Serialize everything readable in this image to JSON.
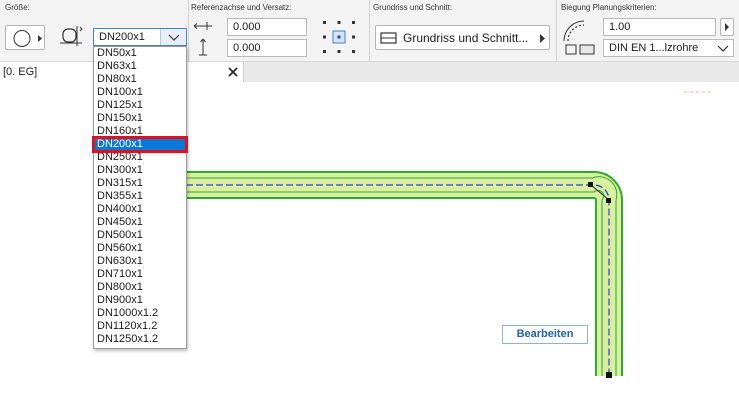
{
  "toolbar": {
    "size_label": "Größe:",
    "size_value": "DN200x1",
    "ref_label": "Referenzachse und Versatz:",
    "offset_x": "0.000",
    "offset_y": "0.000",
    "floorplan_label": "Grundriss und Schnitt:",
    "floorplan_button": "Grundriss und Schnitt...",
    "bend_label": "Biegung Planungskriterien:",
    "bend_value": "1.00",
    "bend_standard": "DIN EN 1...lzrohre"
  },
  "tab": {
    "title": "[0. EG]"
  },
  "size_options": [
    "DN50x1",
    "DN63x1",
    "DN80x1",
    "DN100x1",
    "DN125x1",
    "DN150x1",
    "DN160x1",
    "DN200x1",
    "DN250x1",
    "DN300x1",
    "DN315x1",
    "DN355x1",
    "DN400x1",
    "DN450x1",
    "DN500x1",
    "DN560x1",
    "DN630x1",
    "DN710x1",
    "DN800x1",
    "DN900x1",
    "DN1000x1.2",
    "DN1120x1.2",
    "DN1250x1.2"
  ],
  "selected_index": 7,
  "edit_button": "Bearbeiten",
  "colors": {
    "pipe_fill": "#d8f0a0",
    "pipe_edge": "#2fa82f",
    "pipe_axis": "#2b3fd6",
    "selection": "#0a78d7",
    "highlight_border": "#e0101c"
  },
  "icons": {
    "circle_shape": "circle-icon",
    "section_shape": "pipe-section-icon",
    "chevron": "chevron-down-icon",
    "horizontal_offset": "horizontal-offset-icon",
    "vertical_offset": "vertical-offset-icon",
    "anchor": "anchor-point-icon",
    "floorplan": "floorplan-icon",
    "bend": "bend-radius-icon",
    "close": "close-icon"
  }
}
